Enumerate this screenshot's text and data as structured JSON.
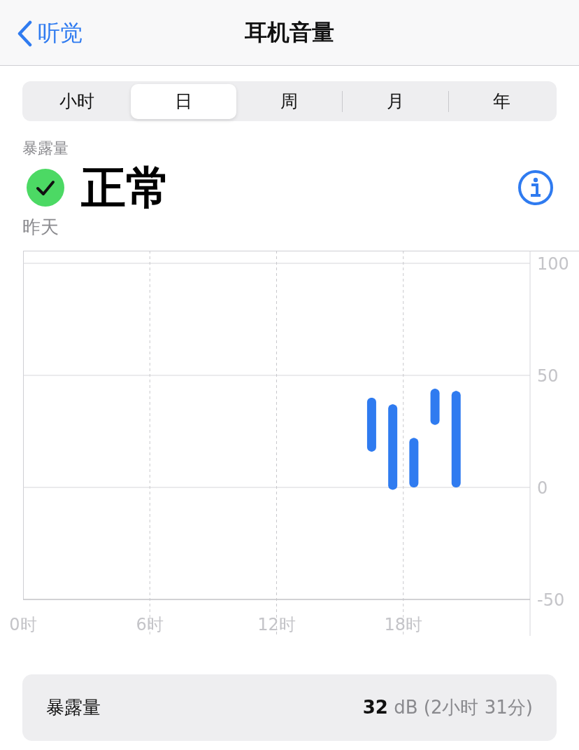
{
  "nav": {
    "back": "听觉",
    "title": "耳机音量"
  },
  "segments": [
    {
      "label": "小时",
      "selected": false
    },
    {
      "label": "日",
      "selected": true
    },
    {
      "label": "周",
      "selected": false
    },
    {
      "label": "月",
      "selected": false
    },
    {
      "label": "年",
      "selected": false
    }
  ],
  "summary": {
    "label": "暴露量",
    "status": "正常",
    "ok": true,
    "date": "昨天"
  },
  "chart_data": {
    "type": "candlestick",
    "x": [
      16.5,
      17.5,
      18.5,
      19.5,
      20.5
    ],
    "xlim": [
      0,
      24
    ],
    "ylim": [
      -50,
      105
    ],
    "grid": true,
    "xticks": [
      {
        "value": 0,
        "label": "0时"
      },
      {
        "value": 6,
        "label": "6时"
      },
      {
        "value": 12,
        "label": "12时"
      },
      {
        "value": 18,
        "label": "18时"
      }
    ],
    "yticks": [
      {
        "value": 100,
        "label": "100"
      },
      {
        "value": 50,
        "label": "50"
      },
      {
        "value": 0,
        "label": "0"
      },
      {
        "value": -50,
        "label": "-50"
      }
    ],
    "series": [
      {
        "color": "#2f7bf0",
        "ohlc": [
          [
            16,
            40,
            16,
            40
          ],
          [
            -1,
            37,
            -1,
            37
          ],
          [
            0,
            22,
            0,
            22
          ],
          [
            28,
            44,
            28,
            44
          ],
          [
            0,
            43,
            0,
            43
          ]
        ]
      }
    ]
  },
  "detail": {
    "label": "暴露量",
    "value": "32",
    "unit": "dB",
    "duration": "(2小时 31分)"
  }
}
